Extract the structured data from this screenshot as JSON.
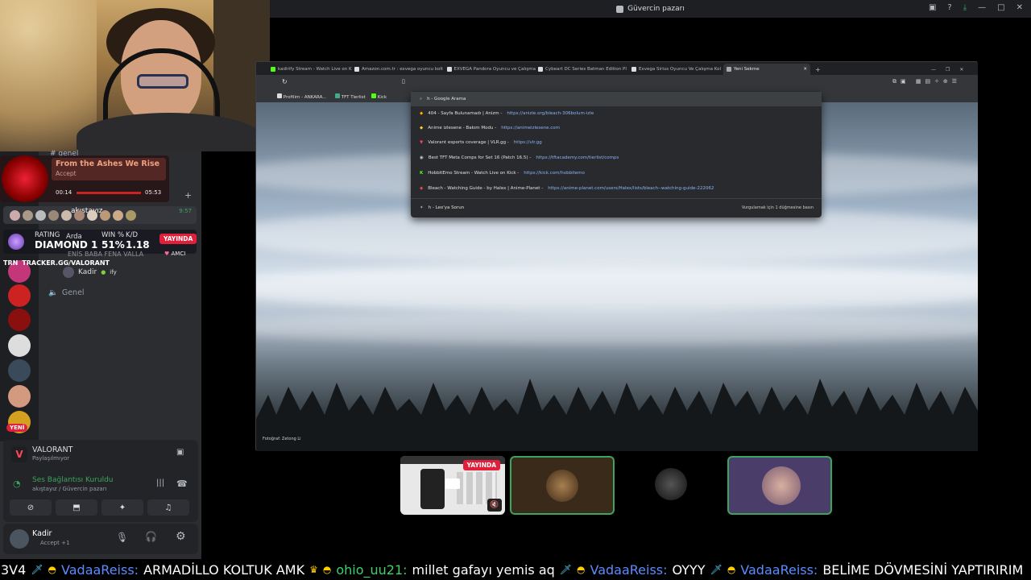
{
  "window": {
    "title": "Güvercin pazarı",
    "icons": [
      "screen-icon",
      "help-icon",
      "download-icon",
      "minimize-icon",
      "maximize-icon",
      "close-icon"
    ]
  },
  "spotify": {
    "title": "From the Ashes We Rise",
    "action": "Accept",
    "elapsed": "00:14",
    "duration": "05:53"
  },
  "sidebar": {
    "channel_top": "genel",
    "voice_channel": "akıştayız",
    "timer": "9:57",
    "users": [
      {
        "name": "Arda"
      },
      {
        "name": "ENİS BABA FENA VALLA",
        "tag": "AMCI"
      },
      {
        "name": "Kadir",
        "tag": "ify"
      }
    ],
    "other_channel": "Genel",
    "new_badge": "YENİ",
    "live_badge": "YAYINDA"
  },
  "rating": {
    "rating_label": "RATING",
    "rating_value": "DIAMOND 1",
    "winpct_label": "WIN %",
    "winpct_value": "51%",
    "kd_label": "K/D",
    "kd_value": "1.18",
    "trn": "TRN",
    "site": "TRACKER.GG/VALORANT"
  },
  "voice_panel": {
    "game": "VALORANT",
    "game_sub": "Paylaşılmıyor",
    "status": "Ses Bağlantısı Kuruldu",
    "status_sub": "akıştayız / Güvercin pazarı"
  },
  "userbar": {
    "name": "Kadir",
    "status": "Accept +1"
  },
  "browser": {
    "tabs": [
      {
        "label": "kadirify Stream - Watch Live on K"
      },
      {
        "label": "Amazon.com.tr : exvega oyuncu kolt"
      },
      {
        "label": "EXVEGA Pandora Oyuncu ve Çalışma"
      },
      {
        "label": "Cybeart DC Series Batman Edition Pl"
      },
      {
        "label": "Exvega Sirius Oyuncu Ve Çalışma Kol"
      },
      {
        "label": "Yeni Sekme"
      }
    ],
    "omnibox_value": "h",
    "bookmarks": [
      "Profilim - ANKARA...",
      "TFT Tierlist",
      "Kick"
    ],
    "suggestions": [
      {
        "title": "h - Google Arama",
        "url": ""
      },
      {
        "title": "404 - Sayfa Bulunamadı | Anizm -",
        "url": "https://anizle.org/bleach-306bolum-izle"
      },
      {
        "title": "Anime izlesene - Bakım Modu -",
        "url": "https://animeizlesene.com"
      },
      {
        "title": "Valorant esports coverage | VLR.gg -",
        "url": "https://vlr.gg"
      },
      {
        "title": "Best TFT Meta Comps for Set 16 (Patch 16.5) -",
        "url": "https://tftacademy.com/tierlist/comps"
      },
      {
        "title": "HobbitEmo Stream - Watch Live on Kick -",
        "url": "https://kick.com/hobbitemo"
      },
      {
        "title": "Bleach - Watching Guide - by Halex | Anime-Planet -",
        "url": "https://anime-planet.com/users/Halex/lists/bleach--watching-guide-222062"
      }
    ],
    "footer_left": "h - Leo'ya Sorun",
    "footer_right": "Vurgulamak için 1 düğmesine basın",
    "credit": "Fotoğraf: Zetong Li"
  },
  "tiles": {
    "live_badge": "YAYINDA"
  },
  "ticker": [
    {
      "user": "",
      "text": "3V4"
    },
    {
      "user": "VadaaReiss:",
      "text": "ARMADİLLO KOLTUK AMK"
    },
    {
      "user": "ohio_uu21:",
      "text": "millet gafayı yemis aq",
      "green": true
    },
    {
      "user": "VadaaReiss:",
      "text": "OYYY"
    },
    {
      "user": "VadaaReiss:",
      "text": "BELİME DÖVMESİNİ YAPTIRIRIM"
    }
  ],
  "colors": {
    "discord_bg": "#2b2d31",
    "live_red": "#e0203a",
    "speaking_green": "#3ba55c",
    "link_blue": "#8ab4f8"
  }
}
